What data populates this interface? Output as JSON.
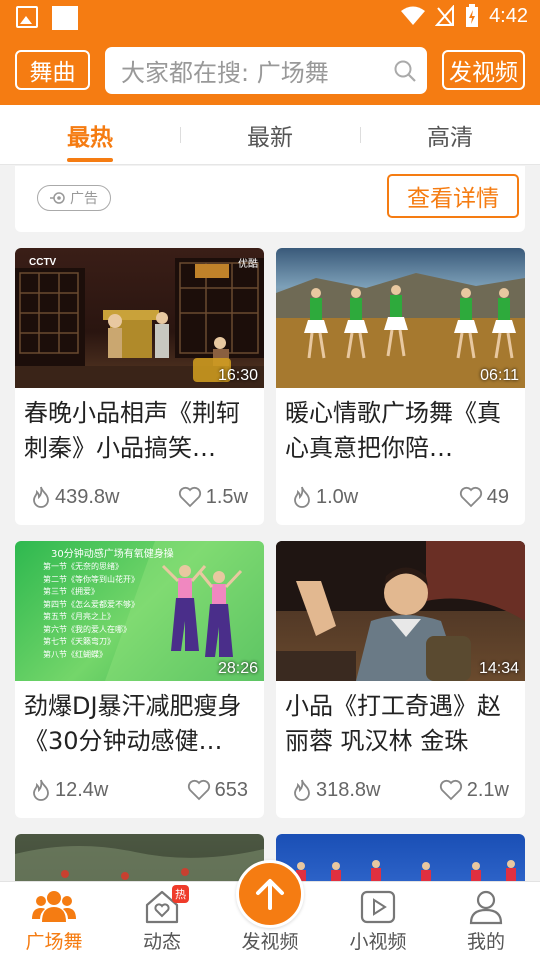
{
  "status_bar": {
    "time": "4:42"
  },
  "header": {
    "dance_button": "舞曲",
    "search_placeholder": "大家都在搜: 广场舞",
    "upload_button": "发视频"
  },
  "tabs": [
    {
      "label": "最热",
      "active": true
    },
    {
      "label": "最新",
      "active": false
    },
    {
      "label": "高清",
      "active": false
    }
  ],
  "ad": {
    "tag": "广告",
    "button": "查看详情"
  },
  "videos": [
    {
      "title": "春晚小品相声《荆轲刺秦》小品搞笑…",
      "duration": "16:30",
      "views": "439.8w",
      "likes": "1.5w"
    },
    {
      "title": "暖心情歌广场舞《真心真意把你陪…",
      "duration": "06:11",
      "views": "1.0w",
      "likes": "49"
    },
    {
      "title": "劲爆DJ暴汗减肥瘦身《30分钟动感健…",
      "duration": "28:26",
      "views": "12.4w",
      "likes": "653"
    },
    {
      "title": "小品《打工奇遇》赵丽蓉 巩汉林 金珠",
      "duration": "14:34",
      "views": "318.8w",
      "likes": "2.1w"
    }
  ],
  "thumb_text": {
    "v1_logo": "CCTV",
    "v1_corner": "优酷",
    "v3_heading": "30分钟动感广场有氧健身操",
    "v3_lines": [
      "第一节《无奈的思绪》",
      "第二节《等你等到山花开》",
      "第三节《拥爱》",
      "第四节《怎么爱都爱不够》",
      "第五节《月亮之上》",
      "第六节《我的爱人在哪》",
      "第七节《天籁弯刀》",
      "第八节《红蝴蝶》"
    ]
  },
  "bottom_nav": [
    {
      "label": "广场舞",
      "icon": "people-icon",
      "active": true
    },
    {
      "label": "动态",
      "icon": "home-heart-icon",
      "badge": "热",
      "active": false
    },
    {
      "label": "发视频",
      "icon": "upload-arrow-icon",
      "active": false
    },
    {
      "label": "小视频",
      "icon": "play-square-icon",
      "active": false
    },
    {
      "label": "我的",
      "icon": "user-icon",
      "active": false
    }
  ],
  "colors": {
    "accent": "#f57c12",
    "badge": "#ef3b2a"
  }
}
